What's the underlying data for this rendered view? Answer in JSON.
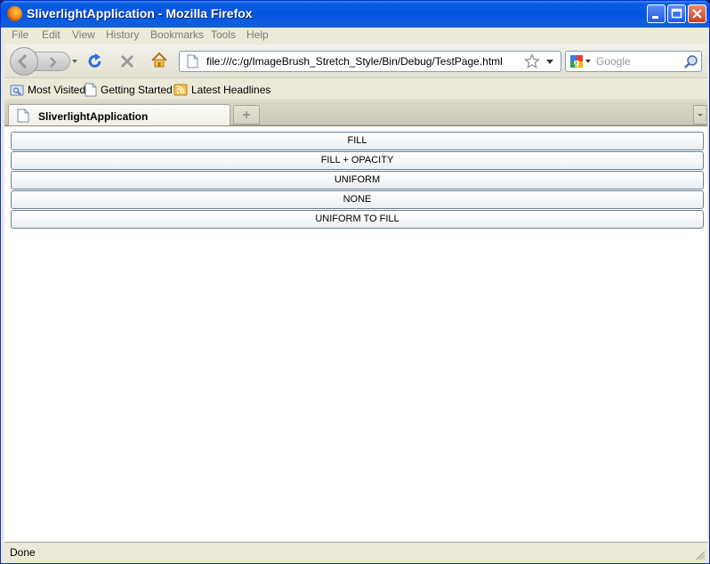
{
  "window": {
    "title": "SliverlightApplication - Mozilla Firefox"
  },
  "menu": [
    "File",
    "Edit",
    "View",
    "History",
    "Bookmarks",
    "Tools",
    "Help"
  ],
  "nav": {
    "url": "file:///c:/g/ImageBrush_Stretch_Style/Bin/Debug/TestPage.html",
    "search_placeholder": "Google"
  },
  "bookmarks": [
    "Most Visited",
    "Getting Started",
    "Latest Headlines"
  ],
  "tabs": [
    {
      "label": "SliverlightApplication",
      "active": true
    }
  ],
  "content": {
    "buttons": [
      "FILL",
      "FILL + OPACITY",
      "UNIFORM",
      "NONE",
      "UNIFORM TO FILL"
    ]
  },
  "status": {
    "text": "Done"
  },
  "colors": {
    "titlebar": "#0553e3",
    "chrome": "#ece9d8",
    "button_border": "#6f7f93"
  },
  "icons": [
    "firefox-logo-icon",
    "minimize-icon",
    "maximize-icon",
    "close-icon",
    "back-icon",
    "forward-icon",
    "reload-icon",
    "stop-icon",
    "home-icon",
    "page-icon",
    "star-icon",
    "google-icon",
    "magnifier-icon",
    "rss-icon"
  ]
}
